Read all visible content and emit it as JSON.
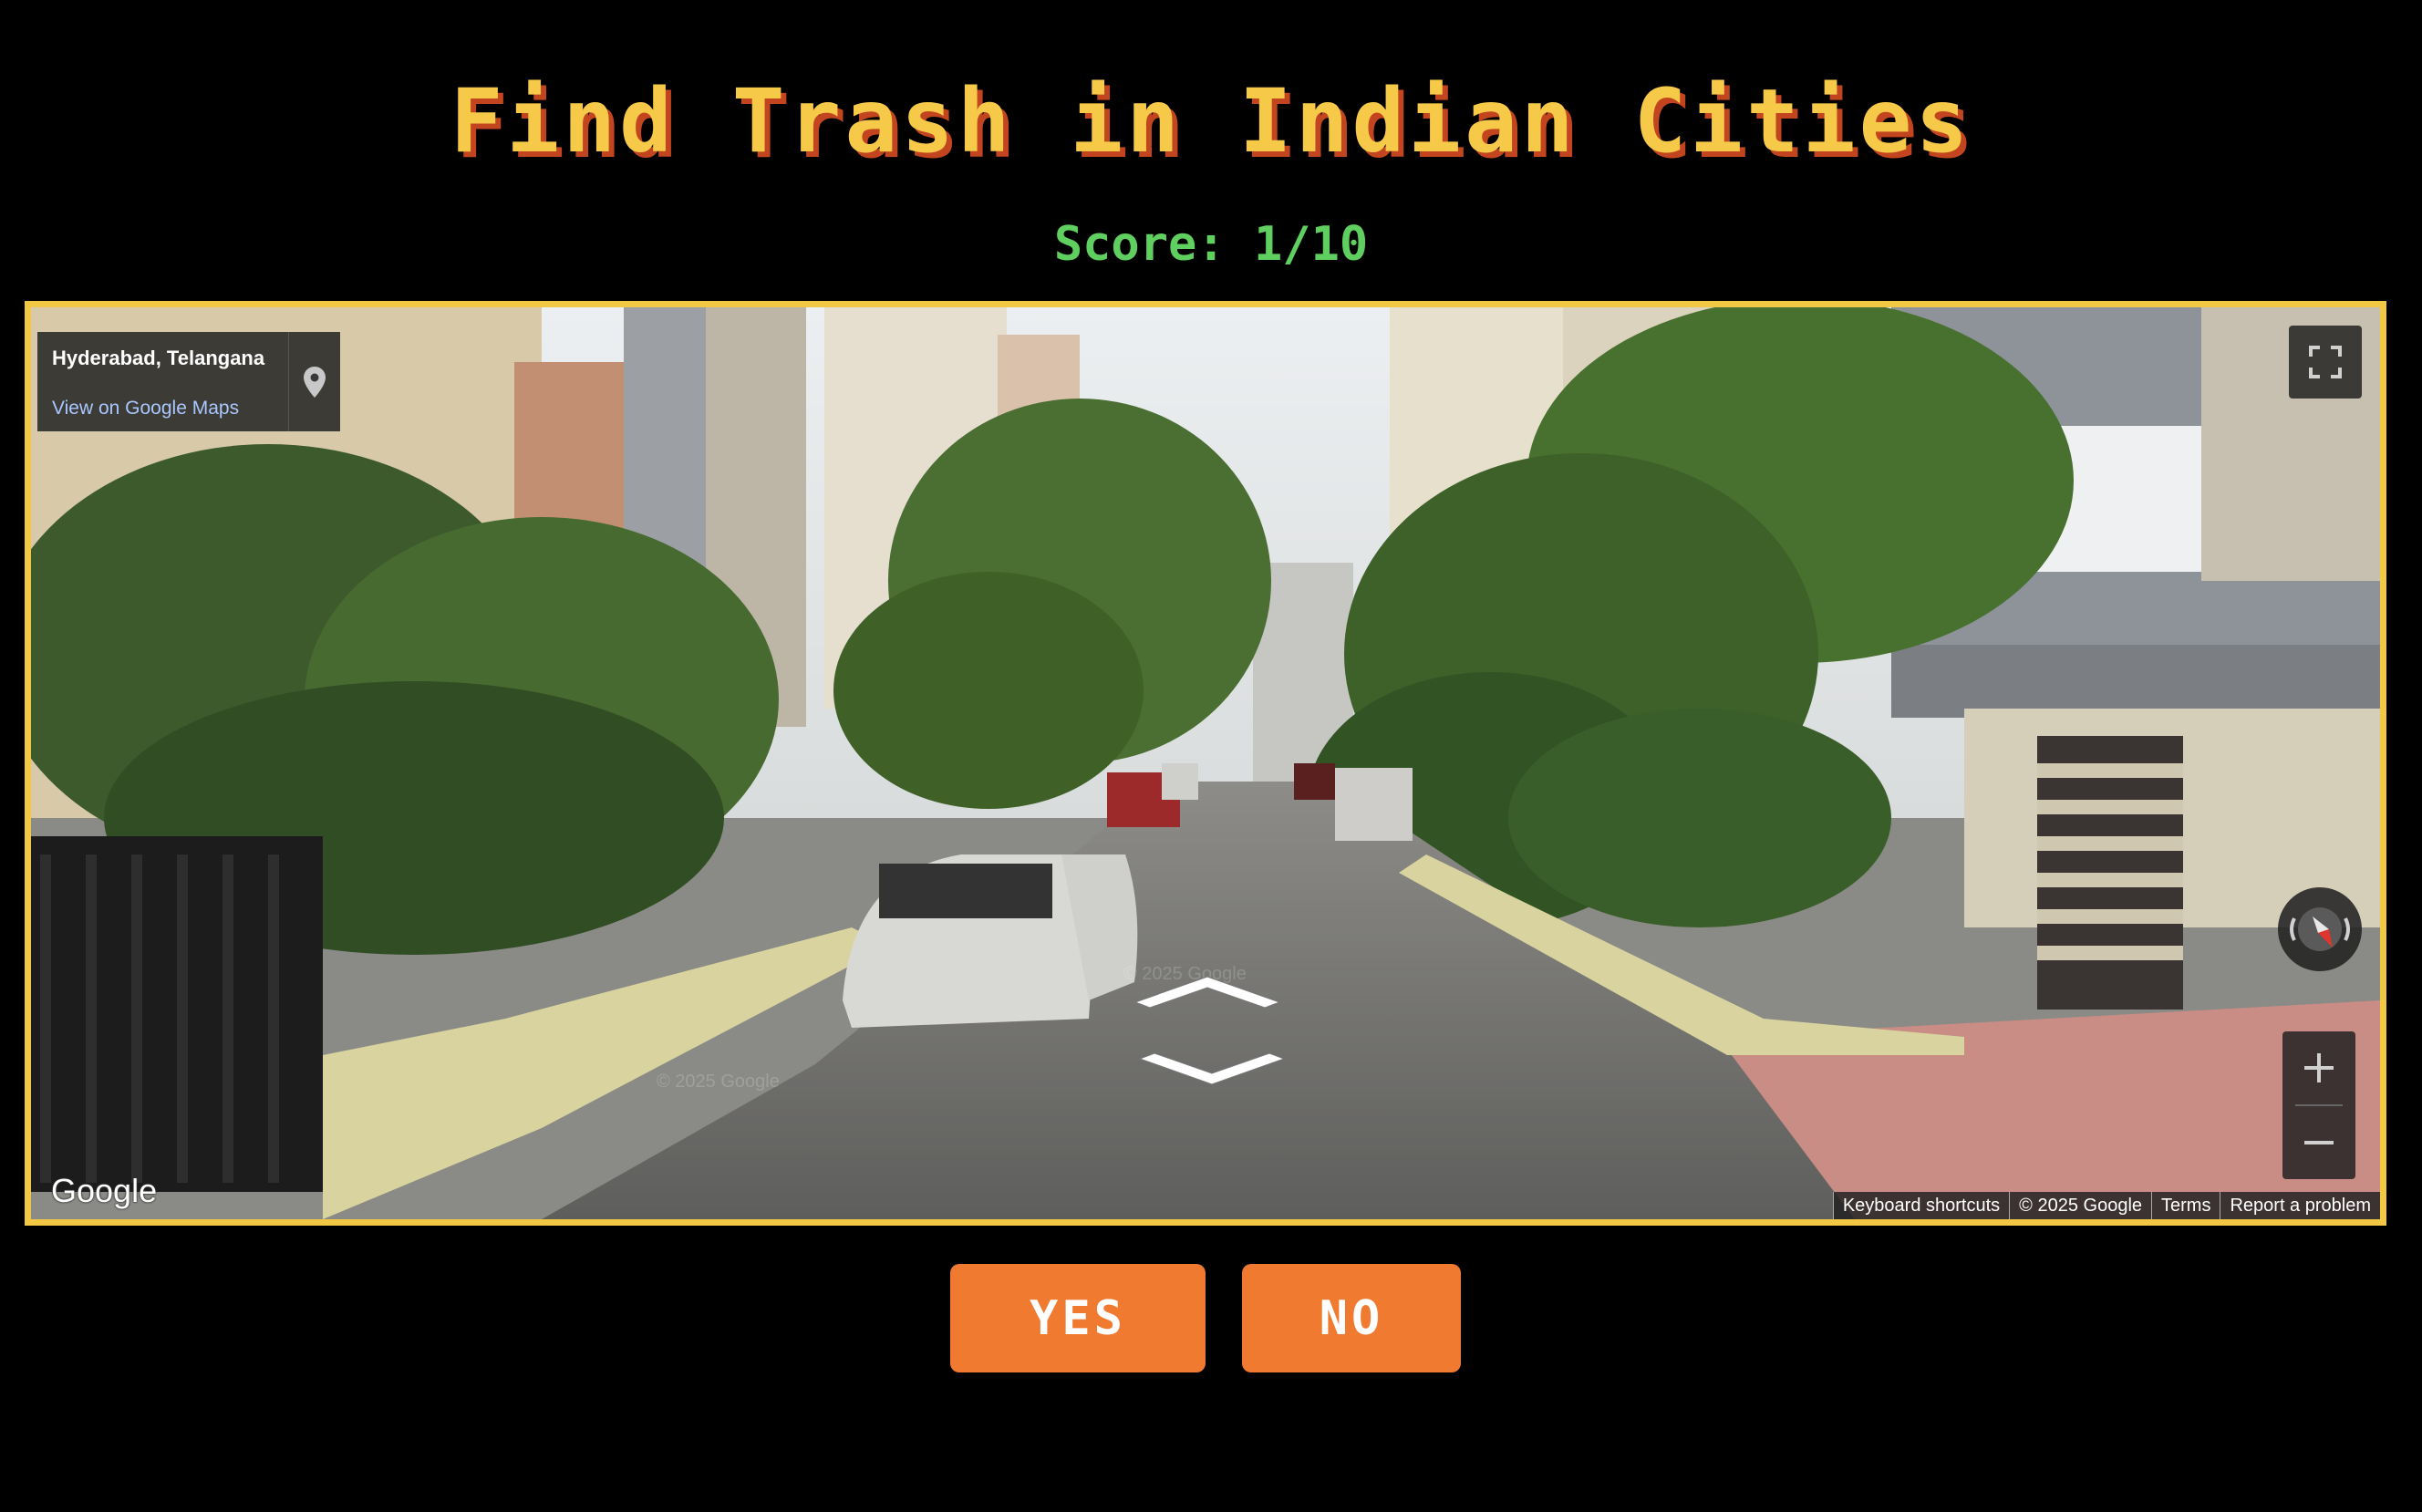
{
  "game": {
    "title": "Find Trash in Indian Cities",
    "score_text": "Score: 1/10"
  },
  "street_view": {
    "location": "Hyderabad, Telangana",
    "view_link": "View on Google Maps",
    "logo": "Google",
    "watermark": "© 2025 Google",
    "attribution": {
      "keyboard_shortcuts": "Keyboard shortcuts",
      "copyright": "© 2025 Google",
      "terms": "Terms",
      "report": "Report a problem"
    },
    "icons": [
      "map-pin-icon",
      "fullscreen-icon",
      "compass-icon",
      "zoom-in-icon",
      "zoom-out-icon",
      "nav-forward-arrow",
      "nav-back-arrow"
    ]
  },
  "answers": {
    "yes_label": "YES",
    "no_label": "NO"
  },
  "colors": {
    "background": "#000000",
    "title": "#f7c948",
    "title_shadow": "#c2451f",
    "score": "#5fcf5f",
    "frame_border": "#f2c744",
    "button": "#ef7a30"
  }
}
